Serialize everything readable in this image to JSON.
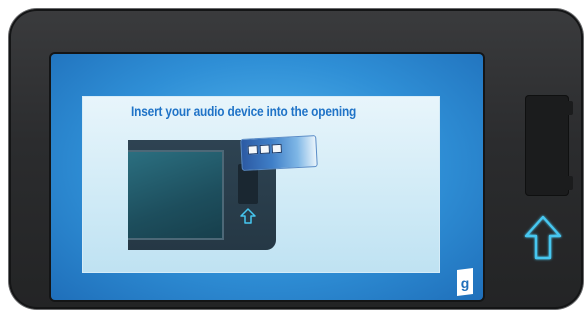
{
  "screen": {
    "instruction": "Insert your audio device into the opening",
    "logo_letter": "g"
  },
  "icons": {
    "insert_arrow": "arrow-up-icon",
    "mini_arrow": "arrow-up-icon",
    "logo": "brand-logo-icon"
  },
  "colors": {
    "bezel": "#2b2c2e",
    "screen_blue": "#2f8fd6",
    "panel_bg": "#cfeaf6",
    "instruction_text": "#1f73c7",
    "arrow_cyan": "#46c7f0"
  }
}
